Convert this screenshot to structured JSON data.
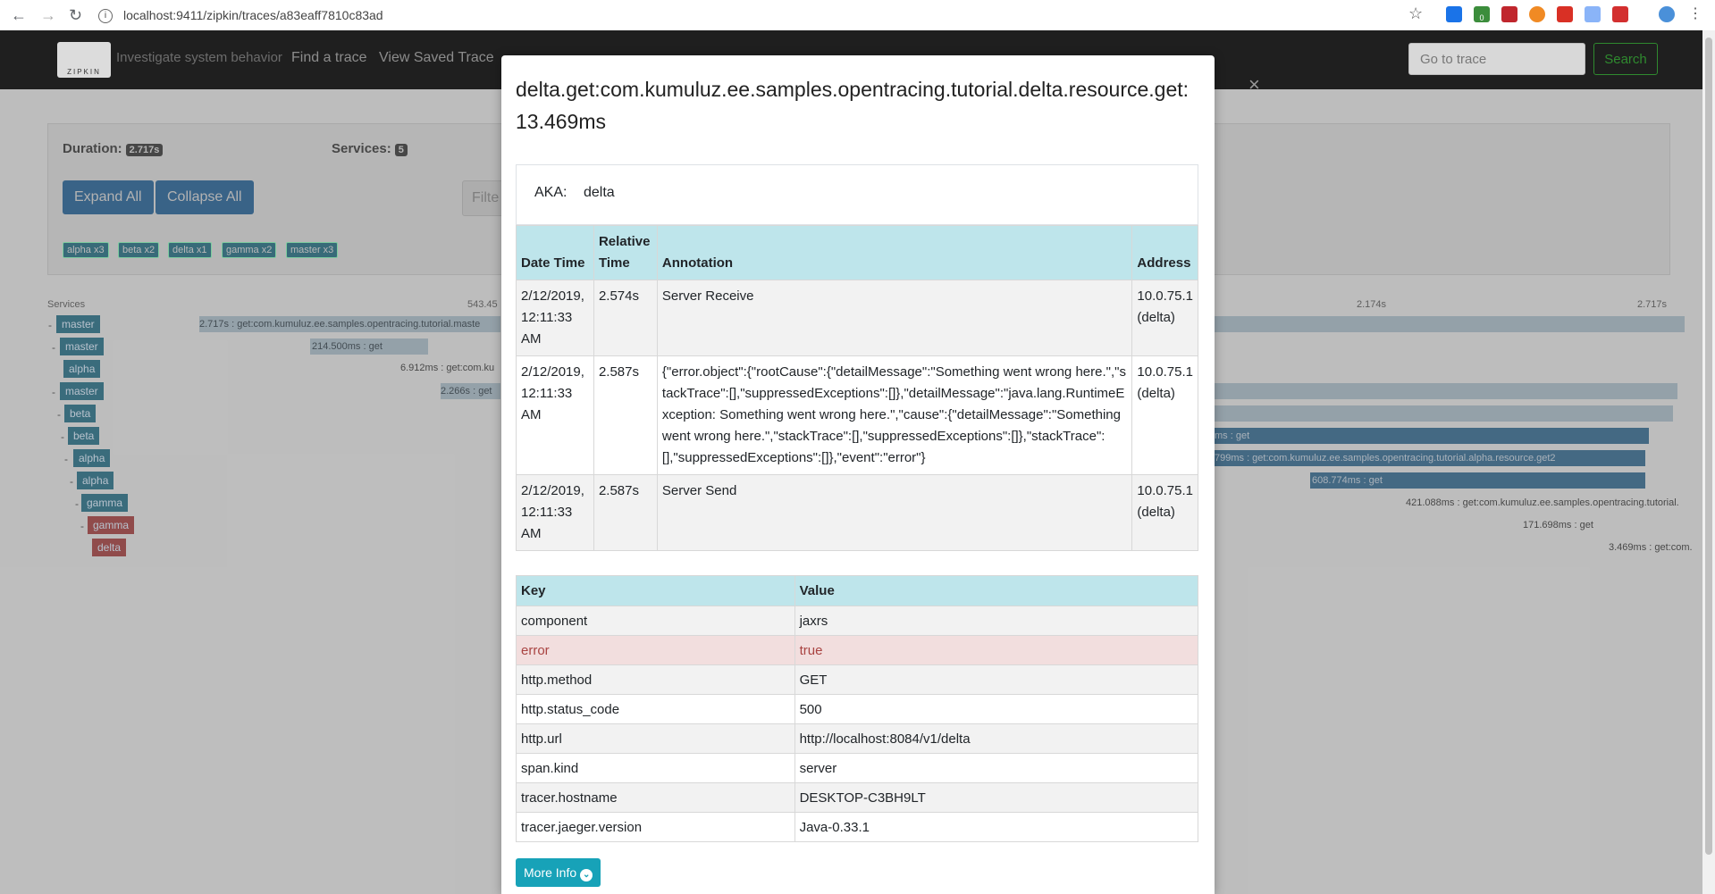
{
  "browser": {
    "url": "localhost:9411/zipkin/traces/a83eaff7810c83ad",
    "back_glyph": "←",
    "forward_glyph": "→",
    "reload_glyph": "↻",
    "star_glyph": "☆",
    "ext_badge": "0"
  },
  "header": {
    "logo_text": "ZIPKIN",
    "tagline": "Investigate system behavior",
    "nav": [
      "Find a trace",
      "View Saved Trace"
    ],
    "goto_placeholder": "Go to trace",
    "search_label": "Search"
  },
  "summary": {
    "duration_label": "Duration:",
    "duration_value": "2.717s",
    "services_label": "Services:",
    "services_value": "5",
    "expand_label": "Expand All",
    "collapse_label": "Collapse All",
    "filter_placeholder": "Filte",
    "service_badges": [
      "alpha x3",
      "beta x2",
      "delta x1",
      "gamma x2",
      "master x3"
    ]
  },
  "timeline": {
    "services_header": "Services",
    "ticks": [
      "543.45",
      "2.174s",
      "2.717s"
    ],
    "rows": [
      {
        "service": "master",
        "span": "2.717s : get:com.kumuluz.ee.samples.opentracing.tutorial.maste"
      },
      {
        "service": "master",
        "span": "214.500ms : get"
      },
      {
        "service": "alpha",
        "span": "6.912ms : get:com.ku"
      },
      {
        "service": "master",
        "span": "2.266s : get"
      },
      {
        "service": "beta",
        "span": ""
      },
      {
        "service": "beta",
        "span": "ms : get"
      },
      {
        "service": "alpha",
        "span": "799ms : get:com.kumuluz.ee.samples.opentracing.tutorial.alpha.resource.get2"
      },
      {
        "service": "alpha",
        "span": "608.774ms : get"
      },
      {
        "service": "gamma",
        "span": "421.088ms : get:com.kumuluz.ee.samples.opentracing.tutorial."
      },
      {
        "service": "gamma",
        "span": "171.698ms : get"
      },
      {
        "service": "delta",
        "span": "3.469ms : get:com."
      }
    ]
  },
  "modal": {
    "title_line1": "delta.get:com.kumuluz.ee.samples.opentracing.tutorial.delta.resource.get:",
    "title_line2": "13.469ms",
    "close_glyph": "×",
    "aka_label": "AKA:",
    "aka_value": "delta",
    "annotation_headers": {
      "date": "Date Time",
      "relative": "Relative Time",
      "annotation": "Annotation",
      "address": "Address"
    },
    "annotations": [
      {
        "date": "2/12/2019, 12:11:33 AM",
        "relative": "2.574s",
        "annotation": "Server Receive",
        "address": "10.0.75.1 (delta)"
      },
      {
        "date": "2/12/2019, 12:11:33 AM",
        "relative": "2.587s",
        "annotation": "{\"error.object\":{\"rootCause\":{\"detailMessage\":\"Something went wrong here.\",\"stackTrace\":[],\"suppressedExceptions\":[]},\"detailMessage\":\"java.lang.RuntimeException: Something went wrong here.\",\"cause\":{\"detailMessage\":\"Something went wrong here.\",\"stackTrace\":[],\"suppressedExceptions\":[]},\"stackTrace\":[],\"suppressedExceptions\":[]},\"event\":\"error\"}",
        "address": "10.0.75.1 (delta)"
      },
      {
        "date": "2/12/2019, 12:11:33 AM",
        "relative": "2.587s",
        "annotation": "Server Send",
        "address": "10.0.75.1 (delta)"
      }
    ],
    "tag_headers": {
      "key": "Key",
      "value": "Value"
    },
    "tags": [
      {
        "key": "component",
        "value": "jaxrs"
      },
      {
        "key": "error",
        "value": "true"
      },
      {
        "key": "http.method",
        "value": "GET"
      },
      {
        "key": "http.status_code",
        "value": "500"
      },
      {
        "key": "http.url",
        "value": "http://localhost:8084/v1/delta"
      },
      {
        "key": "span.kind",
        "value": "server"
      },
      {
        "key": "tracer.hostname",
        "value": "DESKTOP-C3BH9LT"
      },
      {
        "key": "tracer.jaeger.version",
        "value": "Java-0.33.1"
      }
    ],
    "more_info_label": "More Info",
    "more_info_glyph": "⌄"
  }
}
